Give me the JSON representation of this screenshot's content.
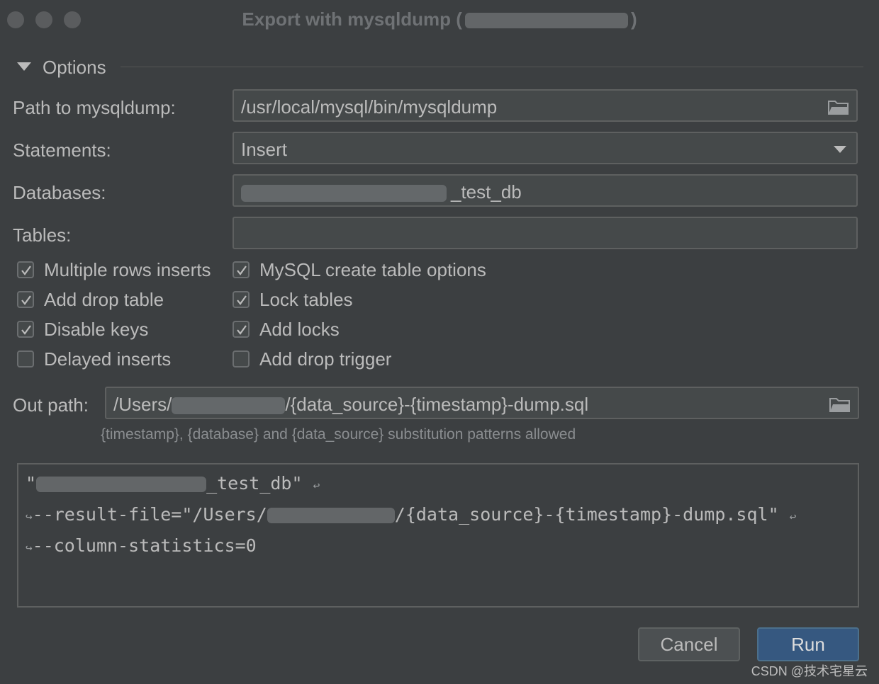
{
  "window": {
    "title": "Export with mysqldump (",
    "title_suffix": ")"
  },
  "options": {
    "section_label": "Options",
    "path_label": "Path to mysqldump:",
    "path_value": "/usr/local/mysql/bin/mysqldump",
    "statements_label": "Statements:",
    "statements_value": "Insert",
    "databases_label": "Databases:",
    "databases_value": "_test_db",
    "tables_label": "Tables:",
    "tables_value": ""
  },
  "checkboxes": {
    "left": [
      {
        "label": "Multiple rows inserts",
        "checked": true
      },
      {
        "label": "Add drop table",
        "checked": true
      },
      {
        "label": "Disable keys",
        "checked": true
      },
      {
        "label": "Delayed inserts",
        "checked": false
      }
    ],
    "right": [
      {
        "label": "MySQL create table options",
        "checked": true
      },
      {
        "label": "Lock tables",
        "checked": true
      },
      {
        "label": "Add locks",
        "checked": true
      },
      {
        "label": "Add drop trigger",
        "checked": false
      }
    ]
  },
  "out_path": {
    "label": "Out path:",
    "value_prefix": "/Users/",
    "value_suffix": "/{data_source}-{timestamp}-dump.sql",
    "hint": "{timestamp}, {database} and {data_source} substitution patterns allowed"
  },
  "command": {
    "line1_prefix": "\"",
    "line1_suffix": "_test_db\"",
    "line2_prefix": "--result-file=\"/Users/",
    "line2_suffix": "/{data_source}-{timestamp}-dump.sql\"",
    "line3": "--column-statistics=0",
    "wrap_end": "↩",
    "wrap_start": "↪"
  },
  "buttons": {
    "cancel": "Cancel",
    "run": "Run"
  },
  "watermark": "CSDN @技术宅星云",
  "colors": {
    "background": "#3c3f41",
    "field": "#45494a",
    "run_button": "#365880",
    "text": "#bbbbbb"
  }
}
